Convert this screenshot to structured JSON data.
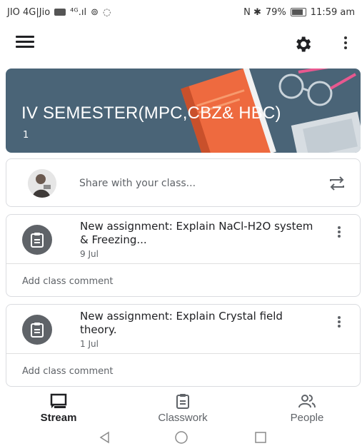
{
  "status_bar": {
    "left": "JIO 4G|Jio",
    "signal_text": "⁴ᴳ.ıl",
    "right_icons": "N ✱",
    "battery": "79%",
    "time": "11:59 am"
  },
  "app_bar": {
    "menu_icon": "menu-icon",
    "settings_icon": "gear-icon",
    "more_icon": "more-vert-icon"
  },
  "banner": {
    "title": "IV SEMESTER(MPC,CBZ& HBC)",
    "subtitle": "1",
    "background": "#4a6477",
    "accent": "#ee6a3f"
  },
  "share": {
    "placeholder": "Share with your class...",
    "icon": "repost-icon"
  },
  "stream": [
    {
      "title": "New assignment: Explain NaCl-H2O system & Freezing...",
      "date": "9 Jul",
      "comment": "Add class comment"
    },
    {
      "title": "New assignment: Explain Crystal field theory.",
      "date": "1 Jul",
      "comment": "Add class comment"
    }
  ],
  "bottom_nav": {
    "stream": "Stream",
    "classwork": "Classwork",
    "people": "People",
    "active": "Stream"
  },
  "system_nav": {
    "back": "back-icon",
    "home": "home-icon",
    "recent": "recent-apps-icon"
  }
}
